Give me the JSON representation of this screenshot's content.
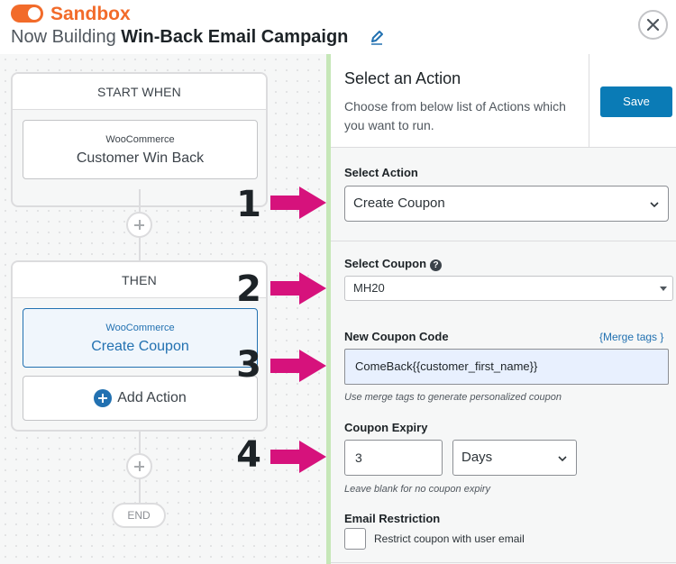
{
  "header": {
    "sandbox_label": "Sandbox",
    "title_prefix": "Now Building",
    "campaign_name": "Win-Back Email Campaign",
    "icons": {
      "edit": "pencil-icon",
      "close": "close-icon",
      "toggle": "toggle-icon"
    },
    "accent_color": "#f26b2a"
  },
  "canvas": {
    "start_block": {
      "heading": "START WHEN",
      "source": "WooCommerce",
      "trigger": "Customer Win Back"
    },
    "then_block": {
      "heading": "THEN",
      "source": "WooCommerce",
      "action": "Create Coupon",
      "add_action_label": "Add Action"
    },
    "end_label": "END"
  },
  "annotations": {
    "numbers": [
      "1",
      "2",
      "3",
      "4"
    ],
    "arrow_color": "#d6127c"
  },
  "panel": {
    "title": "Select an Action",
    "description": "Choose from below list of Actions which you want to run.",
    "save_label": "Save",
    "select_action": {
      "label": "Select Action",
      "value": "Create Coupon"
    },
    "select_coupon": {
      "label": "Select Coupon",
      "value": "MH20"
    },
    "coupon_code": {
      "label": "New Coupon Code",
      "merge_tags_label": "{Merge tags }",
      "value": "ComeBack{{customer_first_name}}",
      "hint": "Use merge tags to generate personalized coupon"
    },
    "coupon_expiry": {
      "label": "Coupon Expiry",
      "value": "3",
      "unit": "Days",
      "hint": "Leave blank for no coupon expiry"
    },
    "email_restriction": {
      "label": "Email Restriction",
      "checkbox_label": "Restrict coupon with user email",
      "checked": false
    }
  }
}
